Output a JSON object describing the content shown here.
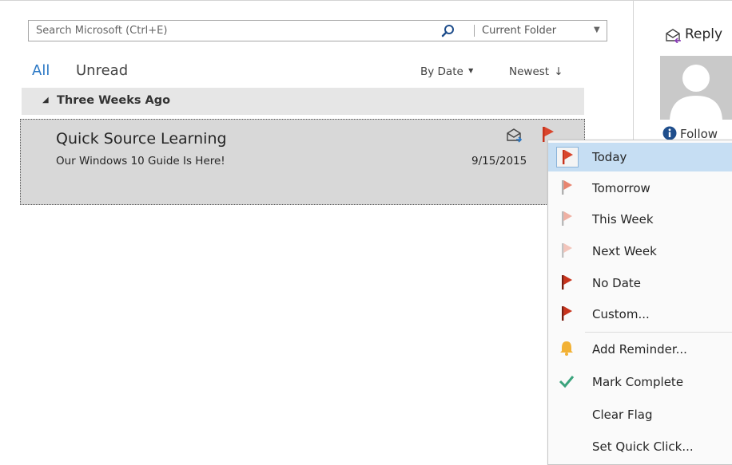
{
  "search": {
    "placeholder": "Search Microsoft (Ctrl+E)",
    "scope": "Current Folder"
  },
  "filters": {
    "all": "All",
    "unread": "Unread",
    "sort_by": "By Date",
    "sort_order": "Newest"
  },
  "group": {
    "title": "Three Weeks Ago"
  },
  "message": {
    "sender": "Quick Source Learning",
    "subject": "Our Windows 10 Guide Is Here!",
    "date": "9/15/2015"
  },
  "reading_pane": {
    "reply_label": "Reply",
    "follow_label": "Follow"
  },
  "flag_menu": {
    "items": [
      {
        "label": "Today",
        "icon": "flag-today-icon"
      },
      {
        "label": "Tomorrow",
        "icon": "flag-tomorrow-icon"
      },
      {
        "label": "This Week",
        "icon": "flag-this-week-icon"
      },
      {
        "label": "Next Week",
        "icon": "flag-next-week-icon"
      },
      {
        "label": "No Date",
        "icon": "flag-no-date-icon"
      },
      {
        "label": "Custom...",
        "icon": "flag-custom-icon"
      },
      {
        "label": "Add Reminder...",
        "icon": "bell-icon"
      },
      {
        "label": "Mark Complete",
        "icon": "checkmark-icon"
      },
      {
        "label": "Clear Flag",
        "icon": ""
      },
      {
        "label": "Set Quick Click...",
        "icon": ""
      }
    ]
  },
  "colors": {
    "accent": "#2b78c5",
    "flag_today": "#d9452c",
    "flag_tomorrow": "#e8846f",
    "flag_this_week": "#efb0a3",
    "flag_next_week": "#f3c5bb",
    "flag_no_date": "#c8331c",
    "menu_highlight": "#c6def3",
    "check": "#3aa37c",
    "bell": "#f2b134"
  }
}
